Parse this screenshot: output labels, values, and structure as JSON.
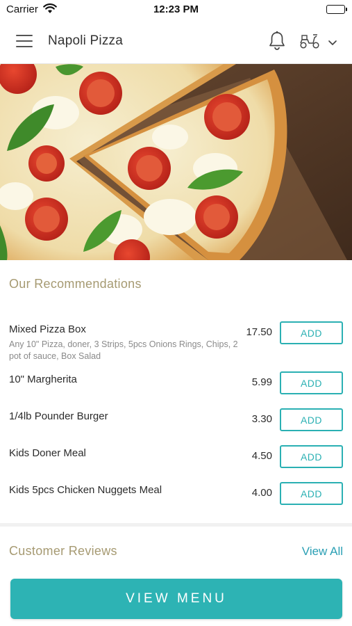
{
  "status_bar": {
    "carrier": "Carrier",
    "time": "12:23 PM"
  },
  "header": {
    "title": "Napoli Pizza",
    "icons": [
      "hamburger-menu-icon",
      "bell-icon",
      "scooter-icon",
      "chevron-down-icon"
    ]
  },
  "hero": {
    "image": "pizza-margherita-photo"
  },
  "recommendations": {
    "title": "Our Recommendations",
    "items": [
      {
        "name": "Mixed Pizza Box",
        "description": "Any 10\" Pizza, doner, 3 Strips, 5pcs Onions Rings, Chips, 2 pot of sauce, Box Salad",
        "price": "17.50",
        "button": "ADD"
      },
      {
        "name": "10\" Margherita",
        "description": "",
        "price": "5.99",
        "button": "ADD"
      },
      {
        "name": "1/4lb Pounder Burger",
        "description": "",
        "price": "3.30",
        "button": "ADD"
      },
      {
        "name": "Kids Doner Meal",
        "description": "",
        "price": "4.50",
        "button": "ADD"
      },
      {
        "name": "Kids 5pcs Chicken Nuggets Meal",
        "description": "",
        "price": "4.00",
        "button": "ADD"
      }
    ]
  },
  "reviews": {
    "title": "Customer Reviews",
    "view_all": "View All"
  },
  "footer": {
    "view_menu": "VIEW MENU"
  },
  "colors": {
    "accent": "#2db3b4",
    "section_title": "#a69a72",
    "link": "#2a9fb4"
  }
}
